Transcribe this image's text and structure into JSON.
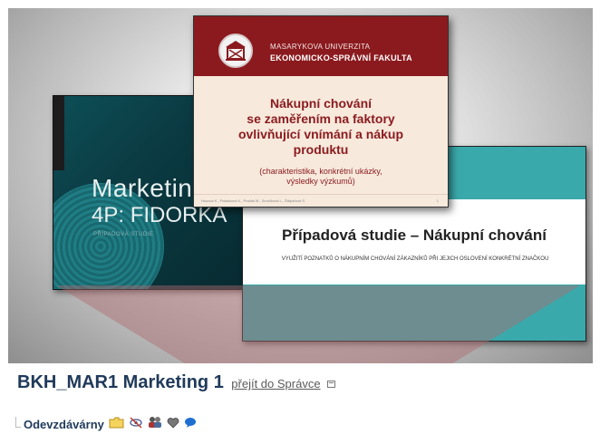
{
  "slides": {
    "marketing": {
      "title_line1": "Marketing",
      "title_line2": "4P: FIDORKA",
      "subtitle": "PŘÍPADOVÁ STUDIE"
    },
    "mu": {
      "university": "MASARYKOVA UNIVERZITA",
      "faculty": "EKONOMICKO-SPRÁVNÍ FAKULTA",
      "title_line1": "Nákupní chování",
      "title_line2": "se zaměřením na faktory",
      "title_line3": "ovlivňující vnímání a nákup",
      "title_line4": "produktu",
      "paren_line1": "(charakteristika, konkrétní ukázky,",
      "paren_line2": "výsledky výzkumů)",
      "footer": "Husová K., Palánková K., Pražák M., Smolíková L., Štěpařová S.",
      "page": "1"
    },
    "case_study": {
      "title": "Případová studie – Nákupní chování",
      "subtitle": "VYUŽITÍ POZNATKŮ O NÁKUPNÍM CHOVÁNÍ ZÁKAZNÍKŮ PŘI JEJICH OSLOVENÍ KONKRÉTNÍ ZNAČKOU"
    }
  },
  "course": {
    "title": "BKH_MAR1 Marketing 1",
    "admin_link": "přejít do Správce",
    "files_label": "Odevzdávárny"
  },
  "icons": {
    "admin": "admin-window-icon",
    "row": [
      "folder-icon",
      "eye-off-icon",
      "people-icon",
      "heart-icon",
      "chat-bubble-icon"
    ]
  },
  "colors": {
    "course_title": "#1f3a5a",
    "mu_red": "#8b1a1e",
    "teal": "#3aa9ac"
  }
}
